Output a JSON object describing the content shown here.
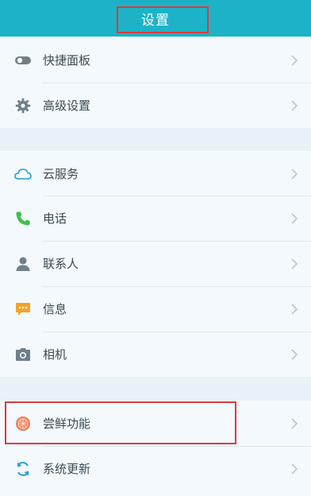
{
  "header": {
    "title": "设置"
  },
  "groups": [
    {
      "items": [
        {
          "label": "快捷面板",
          "icon": "toggle-icon"
        },
        {
          "label": "高级设置",
          "icon": "gear-icon"
        }
      ]
    },
    {
      "items": [
        {
          "label": "云服务",
          "icon": "cloud-icon"
        },
        {
          "label": "电话",
          "icon": "phone-icon"
        },
        {
          "label": "联系人",
          "icon": "person-icon"
        },
        {
          "label": "信息",
          "icon": "message-icon"
        },
        {
          "label": "相机",
          "icon": "camera-icon"
        }
      ]
    },
    {
      "items": [
        {
          "label": "尝鲜功能",
          "icon": "lab-icon"
        },
        {
          "label": "系统更新",
          "icon": "refresh-icon"
        }
      ]
    }
  ],
  "colors": {
    "header": "#1cb3c8",
    "annotation": "#e0393e",
    "cloud": "#1aa3d9",
    "phone": "#3fbf4a",
    "message": "#f4a32a",
    "lab": "#f07a55",
    "refresh": "#2a9ed9"
  }
}
